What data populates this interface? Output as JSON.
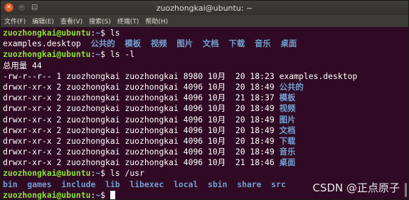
{
  "window": {
    "title": "zuozhongkai@ubuntu: ~",
    "buttons": [
      {
        "name": "close-button",
        "glyph": "×"
      },
      {
        "name": "minimize-button",
        "glyph": "–"
      },
      {
        "name": "maximize-button",
        "glyph": "□"
      }
    ]
  },
  "menu": [
    "文件(F)",
    "编辑(E)",
    "查看(V)",
    "搜索(S)",
    "终端(T)",
    "帮助(H)"
  ],
  "prompt": {
    "user": "zuozhongkai@ubuntu",
    "sep": ":",
    "path": "~",
    "sym": "$ "
  },
  "commands": {
    "c1": "ls",
    "c2": "ls -l",
    "c3": "ls /usr"
  },
  "ls_output": {
    "file": "examples.desktop",
    "dirs": [
      "公共的",
      "模板",
      "视频",
      "图片",
      "文档",
      "下载",
      "音乐",
      "桌面"
    ]
  },
  "total_line": "总用量 44",
  "ll_rows": [
    {
      "prefix": "-rw-r--r-- 1 zuozhongkai zuozhongkai 8980 10月  20 18:23 ",
      "name": "examples.desktop",
      "dir": false
    },
    {
      "prefix": "drwxr-xr-x 2 zuozhongkai zuozhongkai 4096 10月  20 18:49 ",
      "name": "公共的",
      "dir": true
    },
    {
      "prefix": "drwxr-xr-x 2 zuozhongkai zuozhongkai 4096 10月  21 18:37 ",
      "name": "模板",
      "dir": true
    },
    {
      "prefix": "drwxr-xr-x 2 zuozhongkai zuozhongkai 4096 10月  20 18:49 ",
      "name": "视频",
      "dir": true
    },
    {
      "prefix": "drwxr-xr-x 2 zuozhongkai zuozhongkai 4096 10月  20 18:49 ",
      "name": "图片",
      "dir": true
    },
    {
      "prefix": "drwxr-xr-x 2 zuozhongkai zuozhongkai 4096 10月  20 18:49 ",
      "name": "文档",
      "dir": true
    },
    {
      "prefix": "drwxr-xr-x 2 zuozhongkai zuozhongkai 4096 10月  20 18:49 ",
      "name": "下载",
      "dir": true
    },
    {
      "prefix": "drwxr-xr-x 2 zuozhongkai zuozhongkai 4096 10月  20 18:49 ",
      "name": "音乐",
      "dir": true
    },
    {
      "prefix": "drwxr-xr-x 2 zuozhongkai zuozhongkai 4096 10月  21 18:46 ",
      "name": "桌面",
      "dir": true
    }
  ],
  "usr_dirs": [
    "bin",
    "games",
    "include",
    "lib",
    "libexec",
    "local",
    "sbin",
    "share",
    "src"
  ],
  "watermark": "CSDN @正点原子",
  "colors": {
    "background": "#300a24",
    "prompt_user": "#8ae234",
    "directory": "#729fcf",
    "text": "#ffffff"
  }
}
